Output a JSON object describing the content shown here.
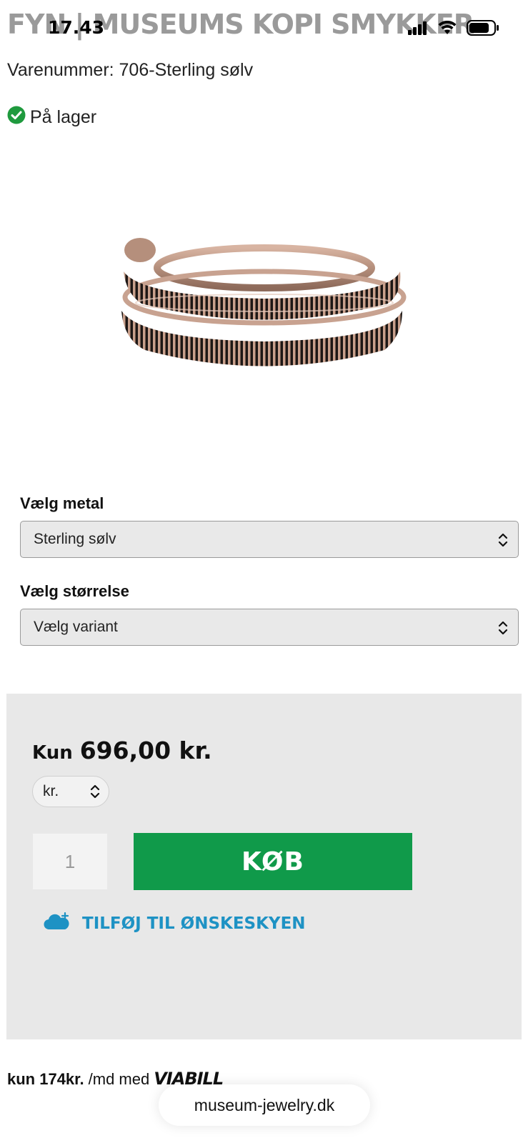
{
  "header": {
    "title": "FYN | MUSEUMS KOPI SMYKKER"
  },
  "status_bar": {
    "time": "17.43"
  },
  "product": {
    "sku": "Varenummer: 706-Sterling sølv",
    "stock": "På lager",
    "image_alt": "ring-image"
  },
  "options": {
    "metal_label": "Vælg metal",
    "metal_value": "Sterling sølv",
    "size_label": "Vælg størrelse",
    "size_value": "Vælg variant"
  },
  "buy": {
    "price_prefix": "Kun",
    "price": "696,00 kr.",
    "currency": "kr.",
    "quantity": "1",
    "buy_label": "KØB",
    "wishlist_label": "TILFØJ TIL ØNSKESKYEN"
  },
  "financing": {
    "prefix": "kun 174kr.",
    "suffix": "/md med",
    "provider": "VIABILL"
  },
  "browser": {
    "url": "museum-jewelry.dk"
  },
  "colors": {
    "buy_button": "#109a4a",
    "wishlist": "#1e92c4",
    "stock_icon": "#1f9a3e",
    "panel": "#e8e8e8"
  },
  "icons": {
    "stock": "check-circle-icon",
    "select": "chevron-up-down-icon",
    "wishlist": "cloud-plus-icon"
  }
}
